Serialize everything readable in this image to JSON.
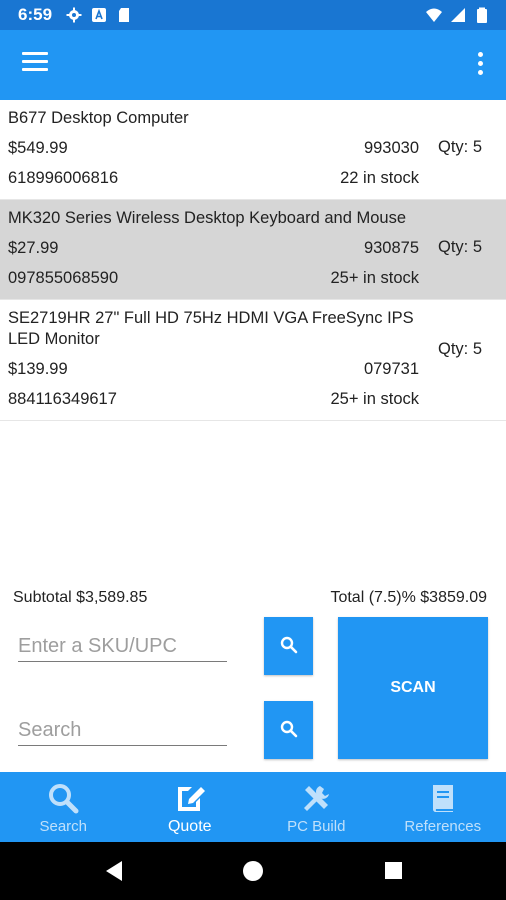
{
  "status_bar": {
    "time": "6:59",
    "left_icons": [
      "gear-icon",
      "a-icon",
      "sd-card-icon"
    ],
    "right_icons": [
      "wifi-icon",
      "signal-icon",
      "battery-icon"
    ]
  },
  "app_bar": {
    "color": "#2196f3",
    "menu_icon": "hamburger-menu-icon",
    "overflow_icon": "more-vert-icon"
  },
  "items": [
    {
      "name": "B677 Desktop Computer",
      "price": "$549.99",
      "sku": "993030",
      "upc": "618996006816",
      "stock": "22 in stock",
      "qty": "Qty: 5",
      "selected": false
    },
    {
      "name": "MK320 Series Wireless Desktop Keyboard and Mouse",
      "price": "$27.99",
      "sku": "930875",
      "upc": "097855068590",
      "stock": "25+ in stock",
      "qty": "Qty: 5",
      "selected": true
    },
    {
      "name": "SE2719HR 27\" Full HD 75Hz HDMI VGA FreeSync IPS LED Monitor",
      "price": "$139.99",
      "sku": "079731",
      "upc": "884116349617",
      "stock": "25+ in stock",
      "qty": "Qty: 5",
      "selected": false
    }
  ],
  "summary": {
    "subtotal": "Subtotal $3,589.85",
    "total": "Total (7.5)% $3859.09"
  },
  "form": {
    "sku_placeholder": "Enter a SKU/UPC",
    "sku_value": "",
    "search_placeholder": "Search",
    "search_value": "",
    "scan_label": "SCAN"
  },
  "bottom_nav": {
    "tabs": [
      {
        "label": "Search",
        "icon": "search-icon",
        "active": false
      },
      {
        "label": "Quote",
        "icon": "quote-edit-icon",
        "active": true
      },
      {
        "label": "PC Build",
        "icon": "tools-icon",
        "active": false
      },
      {
        "label": "References",
        "icon": "book-icon",
        "active": false
      }
    ]
  },
  "colors": {
    "primary": "#2196f3",
    "primary_dark": "#1976d2",
    "selected_row": "#d6d6d6"
  }
}
